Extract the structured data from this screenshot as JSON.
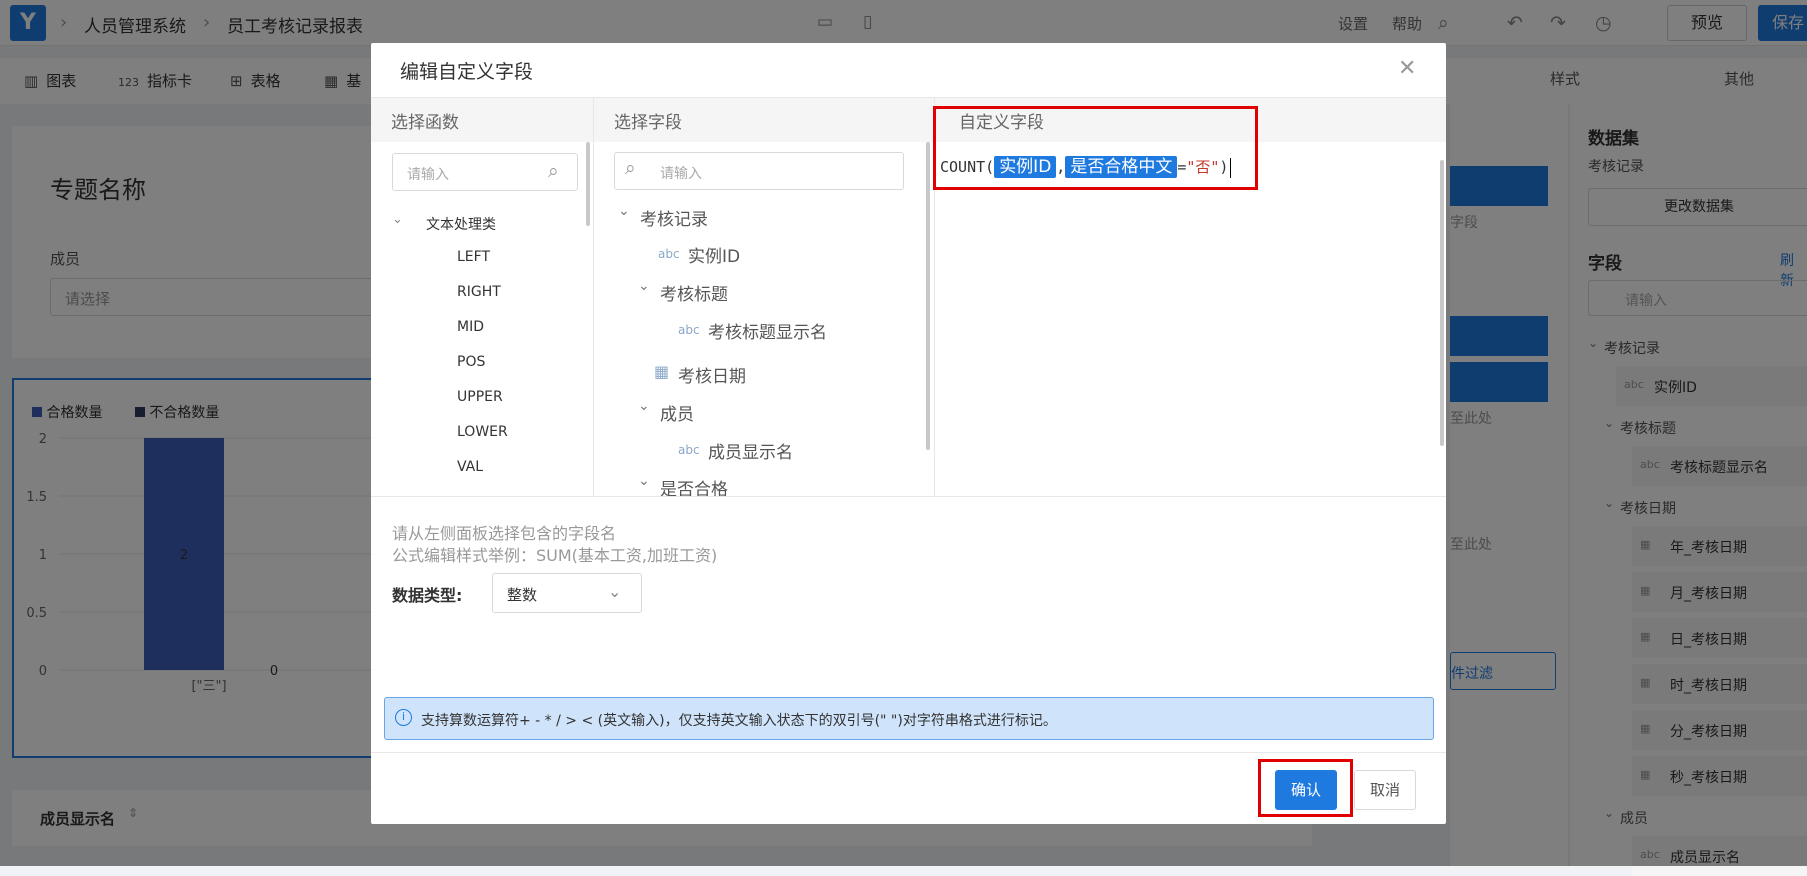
{
  "app": {
    "breadcrumb": [
      "人员管理系统",
      "员工考核记录报表"
    ],
    "header_links": {
      "settings": "设置",
      "help": "帮助"
    },
    "preview_label": "预览",
    "save_label": "保存"
  },
  "toolbar": {
    "items": [
      {
        "icon": "bar-chart-icon",
        "label": "图表"
      },
      {
        "icon": "number-card-icon",
        "icon_text": "123",
        "label": "指标卡"
      },
      {
        "icon": "table-icon",
        "label": "表格"
      },
      {
        "icon": "grid-icon",
        "label": "基"
      }
    ]
  },
  "right_tabs": [
    "样式",
    "其他"
  ],
  "canvas": {
    "topic_title": "专题名称",
    "member_label": "成员",
    "member_placeholder": "请选择",
    "table_header": "成员显示名"
  },
  "chart_data": {
    "type": "bar",
    "categories": [
      "[\"三\"]"
    ],
    "series": [
      {
        "name": "合格数量",
        "values": [
          2
        ],
        "color": "#3d5fbc"
      },
      {
        "name": "不合格数量",
        "values": [
          0
        ],
        "color": "#2d3a5c"
      }
    ],
    "data_labels": [
      "2",
      "0"
    ],
    "ylim": [
      0,
      2
    ],
    "yticks": [
      "2",
      "1.5",
      "1",
      "0.5",
      "0"
    ],
    "legend_position": "top-left",
    "grid": true
  },
  "modal": {
    "title": "编辑自定义字段",
    "functions": {
      "header": "选择函数",
      "search_placeholder": "请输入",
      "group": "文本处理类",
      "items": [
        "LEFT",
        "RIGHT",
        "MID",
        "POS",
        "UPPER",
        "LOWER",
        "VAL"
      ]
    },
    "fields": {
      "header": "选择字段",
      "search_placeholder": "请输入",
      "tree": [
        {
          "label": "考核记录",
          "level": 0,
          "type": "group"
        },
        {
          "label": "实例ID",
          "level": 1,
          "type": "abc"
        },
        {
          "label": "考核标题",
          "level": 1,
          "type": "group"
        },
        {
          "label": "考核标题显示名",
          "level": 2,
          "type": "abc"
        },
        {
          "label": "考核日期",
          "level": 1,
          "type": "date"
        },
        {
          "label": "成员",
          "level": 1,
          "type": "group"
        },
        {
          "label": "成员显示名",
          "level": 2,
          "type": "abc"
        },
        {
          "label": "是否合格",
          "level": 1,
          "type": "group"
        }
      ],
      "abc_tag": "abc"
    },
    "custom": {
      "header": "自定义字段",
      "formula": {
        "func": "COUNT",
        "open": "(",
        "arg1": "实例ID",
        "comma": ",",
        "arg2": "是否合格中文",
        "eq": "=",
        "string": "\"否\"",
        "close": ")"
      }
    },
    "hint_line1": "请从左侧面板选择包含的字段名",
    "hint_line2": "公式编辑样式举例：SUM(基本工资,加班工资)",
    "data_type_label": "数据类型:",
    "data_type_value": "整数",
    "info_text": "支持算数运算符+ - * / > < (英文输入)，仅支持英文输入状态下的双引号(\" \")对字符串格式进行标记。",
    "confirm_label": "确认",
    "cancel_label": "取消"
  },
  "right_panel": {
    "dataset_title": "数据集",
    "dataset_name": "考核记录",
    "change_dataset": "更改数据集",
    "fields_title": "字段",
    "refresh": "刷新",
    "search_placeholder": "请输入",
    "tree": [
      {
        "label": "考核记录",
        "level": 0
      },
      {
        "label": "实例ID",
        "level": 1,
        "tag": "abc"
      },
      {
        "label": "考核标题",
        "level": 1
      },
      {
        "label": "考核标题显示名",
        "level": 2,
        "tag": "abc"
      },
      {
        "label": "考核日期",
        "level": 1
      },
      {
        "label": "年_考核日期",
        "level": 2,
        "tag": "date"
      },
      {
        "label": "月_考核日期",
        "level": 2,
        "tag": "date"
      },
      {
        "label": "日_考核日期",
        "level": 2,
        "tag": "date"
      },
      {
        "label": "时_考核日期",
        "level": 2,
        "tag": "date"
      },
      {
        "label": "分_考核日期",
        "level": 2,
        "tag": "date"
      },
      {
        "label": "秒_考核日期",
        "level": 2,
        "tag": "date"
      },
      {
        "label": "成员",
        "level": 1
      },
      {
        "label": "成员显示名",
        "level": 2,
        "tag": "abc"
      }
    ],
    "mid_panel": {
      "field_hint": "字段",
      "drop_hint_1": "至此处",
      "drop_hint_2": "至此处",
      "filter": "件过滤"
    }
  }
}
